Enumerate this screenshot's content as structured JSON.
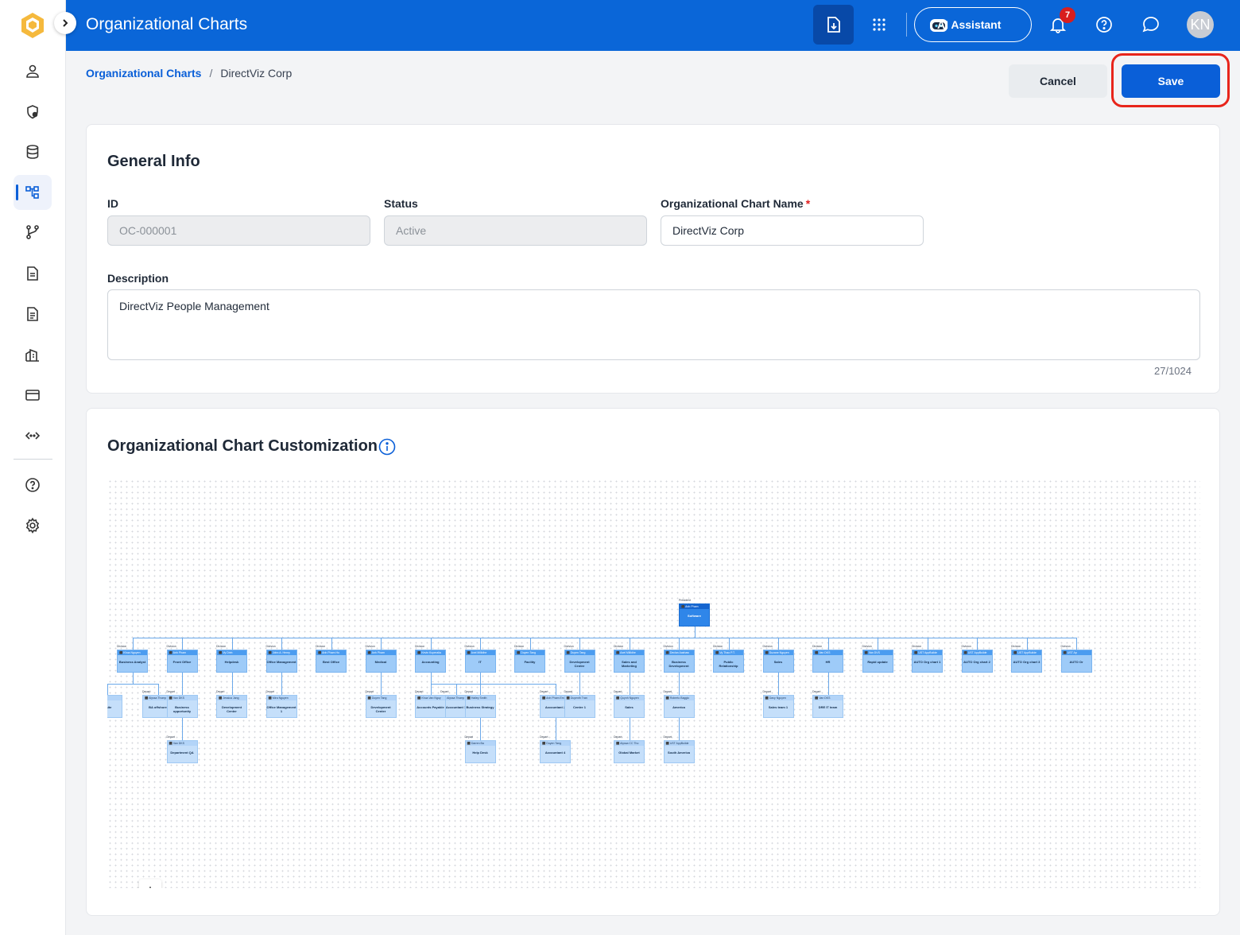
{
  "topbar": {
    "title": "Organizational Charts",
    "ai_label": "AI Assistant",
    "notif_count": "7",
    "avatar_initials": "KN"
  },
  "sidebar": {
    "items": [
      "user-icon",
      "shield-settings-icon",
      "database-icon",
      "org-chart-icon",
      "workflow-icon",
      "document-icon",
      "document-list-icon",
      "building-icon",
      "card-icon",
      "code-icon",
      "help-icon",
      "gear-icon"
    ],
    "active": "org-chart-icon"
  },
  "breadcrumb": {
    "root": "Organizational Charts",
    "current": "DirectViz Corp"
  },
  "actions": {
    "cancel": "Cancel",
    "save": "Save"
  },
  "general": {
    "title": "General Info",
    "id_label": "ID",
    "id_value": "OC-000001",
    "status_label": "Status",
    "status_value": "Active",
    "name_label": "Organizational Chart Name",
    "name_value": "DirectViz Corp",
    "desc_label": "Description",
    "desc_value": "DirectViz People Management",
    "counter": "27/1024"
  },
  "customization": {
    "title": "Organizational Chart Customization"
  },
  "chart": {
    "root": {
      "tag": "President",
      "head": "Anh Pham",
      "name": "Software"
    },
    "divisions": [
      {
        "tag": "Division",
        "head": "Khoa Nguyen",
        "name": "Business Analyst"
      },
      {
        "tag": "Division",
        "head": "Anh Pham",
        "name": "Front Office"
      },
      {
        "tag": "Division",
        "head": "Vy Dinh",
        "name": "Helpdesk"
      },
      {
        "tag": "Division",
        "head": "John A. Henry",
        "name": "Office Management"
      },
      {
        "tag": "Division",
        "head": "Anh Pham Ho",
        "name": "Best Office"
      },
      {
        "tag": "Division",
        "head": "Anh Pham",
        "name": "Medical"
      },
      {
        "tag": "Division",
        "head": "Kevin Kuperalia",
        "name": "Accounting"
      },
      {
        "tag": "Division",
        "head": "Axel Millidhe",
        "name": "IT"
      },
      {
        "tag": "Division",
        "head": "Duyen Tang",
        "name": "Facility"
      },
      {
        "tag": "Division",
        "head": "Duyen Tang",
        "name": "Development Centre"
      },
      {
        "tag": "Division",
        "head": "Axel Millidhe",
        "name": "Sales and Marketing"
      },
      {
        "tag": "Division",
        "head": "Declan Aashaw",
        "name": "Business Development"
      },
      {
        "tag": "Division",
        "head": "Vy Thao P.T.",
        "name": "Public Relationship"
      },
      {
        "tag": "Division",
        "head": "Suzane Nguyen",
        "name": "Sales"
      },
      {
        "tag": "Division",
        "head": "Van DKS",
        "name": "HR"
      },
      {
        "tag": "Division",
        "head": "Van DVS",
        "name": "Rapid update"
      },
      {
        "tag": "Division",
        "head": "UST AppBuilde",
        "name": "AUTO Org chart 1"
      },
      {
        "tag": "Division",
        "head": "UST AppBuilde",
        "name": "AUTO Org chart 2"
      },
      {
        "tag": "Division",
        "head": "UST AppBuilde",
        "name": "AUTO Org chart 3"
      },
      {
        "tag": "Division",
        "head": "UST Ap",
        "name": "AUTO Or"
      }
    ],
    "departments": [
      {
        "tag": "",
        "head": "Tran",
        "name": "onsite"
      },
      {
        "tag": "Depart",
        "head": "Alyssa Thomp",
        "name": "BA offshore"
      },
      {
        "tag": "Depart",
        "head": "Van DKS",
        "name": "Business opportunity"
      },
      {
        "tag": "Depart",
        "head": "Jessica Jang",
        "name": "Development Center"
      },
      {
        "tag": "Depart",
        "head": "Mira Nguyen",
        "name": "Office Management 1"
      },
      {
        "tag": "Depart",
        "head": "Duyen Tang",
        "name": "Development Center"
      },
      {
        "tag": "Depart",
        "head": "Alyssa Thomp",
        "name": "Accountant 1"
      },
      {
        "tag": "Depart",
        "head": "Khoa Van Nguy",
        "name": "Accounts Payable"
      },
      {
        "tag": "Depart",
        "head": "Anh Pham Em",
        "name": "Accountant 2"
      },
      {
        "tag": "Depart",
        "head": "Hailey Smith",
        "name": "Business Strategy"
      },
      {
        "tag": "Depart",
        "head": "Duyenth Tran",
        "name": "Centre 1"
      },
      {
        "tag": "Depart",
        "head": "Quynh Nguyen",
        "name": "Sales"
      },
      {
        "tag": "Depart",
        "head": "Roberto Baggio",
        "name": "America"
      },
      {
        "tag": "Depart",
        "head": "Davy Nguyen",
        "name": "Sales team 1"
      },
      {
        "tag": "Depart",
        "head": "Van DKS",
        "name": "DRE IT team"
      },
      {
        "tag": "Depart",
        "head": "Van DKS",
        "name": "Department QA"
      },
      {
        "tag": "Depart",
        "head": "Duyen Tang",
        "name": "Accountant 4"
      },
      {
        "tag": "Depart",
        "head": "Darren Ba",
        "name": "Help Desk"
      },
      {
        "tag": "Depart",
        "head": "Alyssa CC Tho",
        "name": "Global Market"
      },
      {
        "tag": "Depart",
        "head": "UST AppBuilde",
        "name": "South America"
      }
    ]
  },
  "zoom": {
    "in": "+",
    "out": "−",
    "fit": "⛶"
  }
}
